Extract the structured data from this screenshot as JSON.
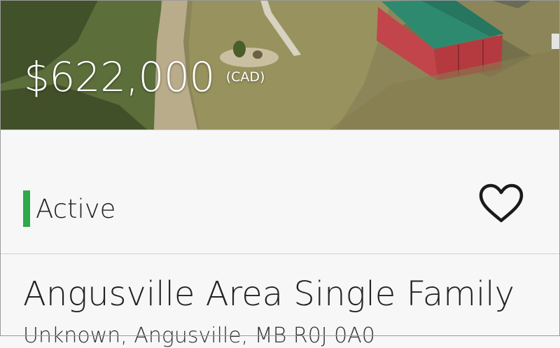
{
  "listing": {
    "price": "$622,000",
    "currency": "(CAD)",
    "status": "Active",
    "status_color": "#2ea84b",
    "title": "Angusville Area Single Family",
    "address": "Unknown, Angusville, MB R0J 0A0"
  },
  "icons": {
    "favorite": "heart-outline-icon"
  },
  "colors": {
    "accent_status": "#2ea84b",
    "background": "#f7f7f7",
    "text": "#222222"
  }
}
